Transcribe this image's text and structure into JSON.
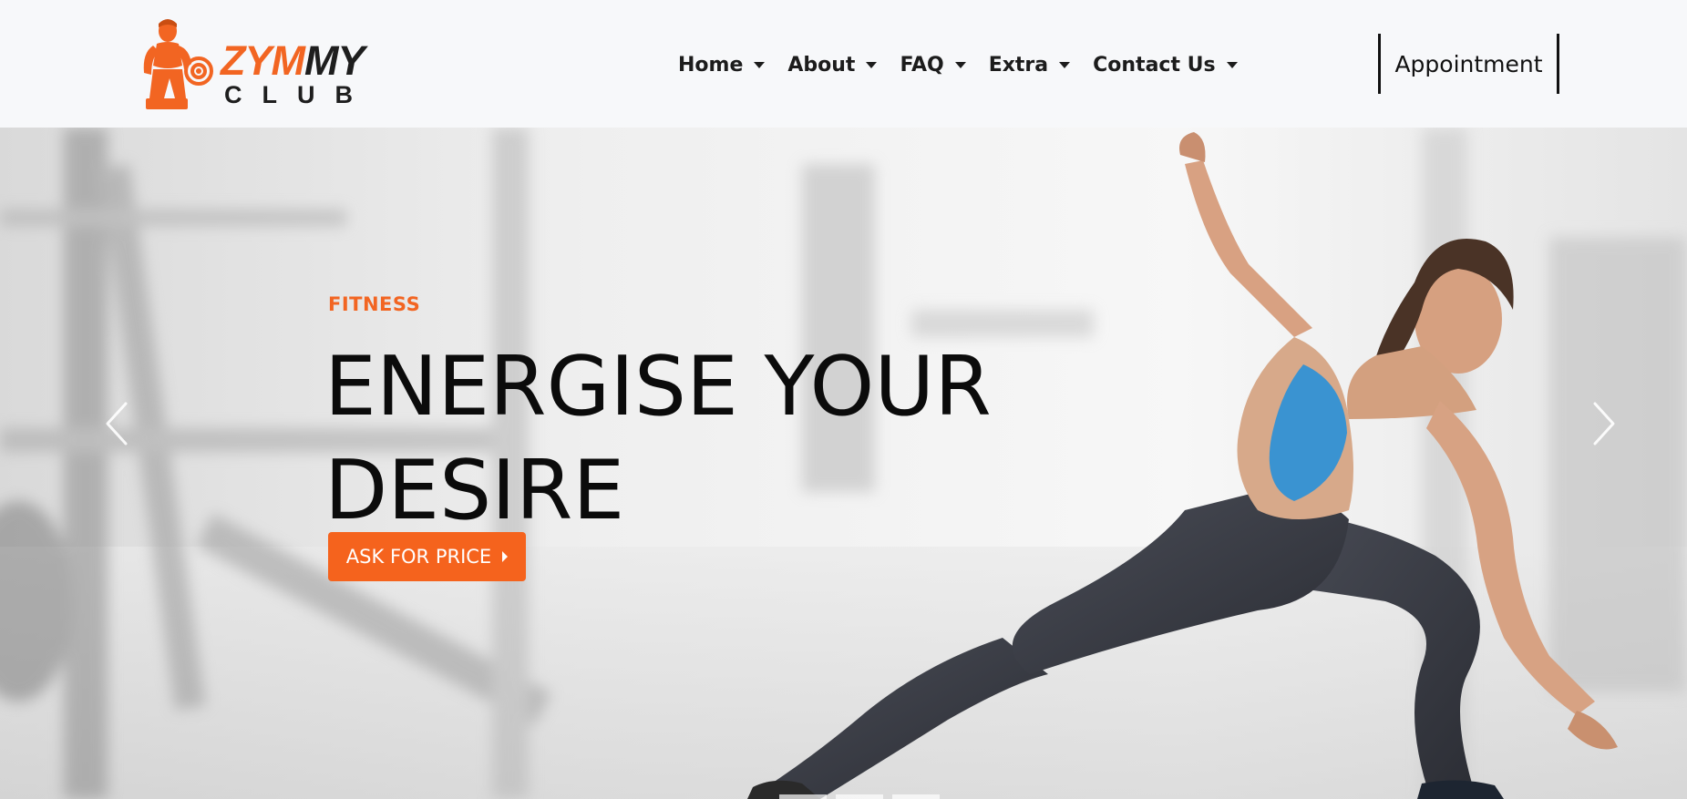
{
  "brand": {
    "word_part1": "ZYM",
    "word_part2": "MY",
    "sub": "CLUB",
    "colors": {
      "accent": "#f26522",
      "dark": "#1e1e1e"
    }
  },
  "nav": {
    "items": [
      {
        "label": "Home"
      },
      {
        "label": "About"
      },
      {
        "label": "FAQ"
      },
      {
        "label": "Extra"
      },
      {
        "label": "Contact Us"
      }
    ],
    "appointment_label": "Appointment"
  },
  "hero": {
    "kicker": "FITNESS",
    "headline_line1": "ENERGISE YOUR",
    "headline_line2": "DESIRE",
    "cta_label": "ASK FOR PRICE",
    "colors": {
      "kicker": "#f26522",
      "cta_bg": "#f5631d",
      "headline": "#0b0b0b"
    }
  },
  "icons": {
    "prev": "chevron-left-icon",
    "next": "chevron-right-icon",
    "cta": "caret-right-icon",
    "dropdown": "caret-down-icon"
  }
}
